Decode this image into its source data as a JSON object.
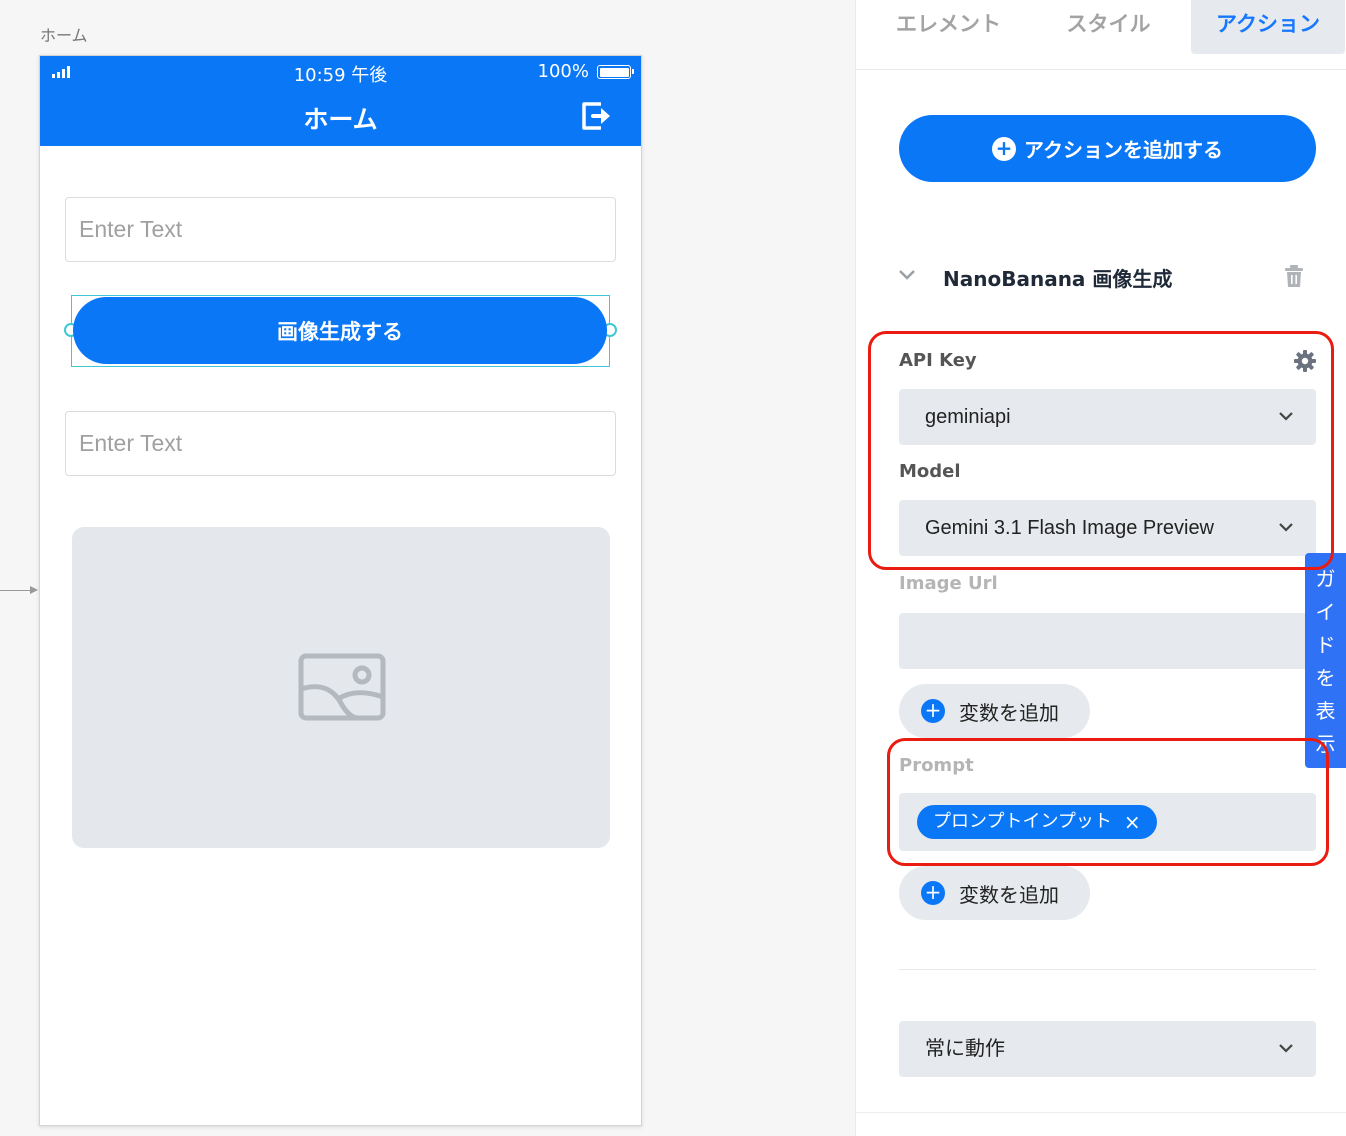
{
  "canvas": {
    "screen_label": "ホーム"
  },
  "phone": {
    "status_time": "10:59 午後",
    "battery_percent": "100%",
    "battery_level": 1.0,
    "header_title": "ホーム",
    "input1_placeholder": "Enter Text",
    "button_label": "画像生成する",
    "input2_placeholder": "Enter Text"
  },
  "panel": {
    "tabs": [
      {
        "label": "エレメント",
        "active": false
      },
      {
        "label": "スタイル",
        "active": false
      },
      {
        "label": "アクション",
        "active": true
      }
    ],
    "add_action_label": "アクションを追加する",
    "action": {
      "title": "NanoBanana 画像生成",
      "fields": {
        "api_key": {
          "label": "API Key",
          "value": "geminiapi"
        },
        "model": {
          "label": "Model",
          "value": "Gemini 3.1 Flash Image Preview"
        },
        "image_url": {
          "label": "Image Url",
          "value": ""
        },
        "prompt": {
          "label": "Prompt",
          "chip": "プロンプトインプット"
        }
      },
      "add_variable_label": "変数を追加",
      "trigger": "常に動作"
    }
  },
  "guide_tab_chars": [
    "ガ",
    "イ",
    "ド",
    "を",
    "表",
    "示"
  ],
  "colors": {
    "primary": "#0a77f7",
    "highlight": "#ea1c11",
    "selection": "#3ec7d6",
    "field_bg": "#e6e9ed"
  }
}
